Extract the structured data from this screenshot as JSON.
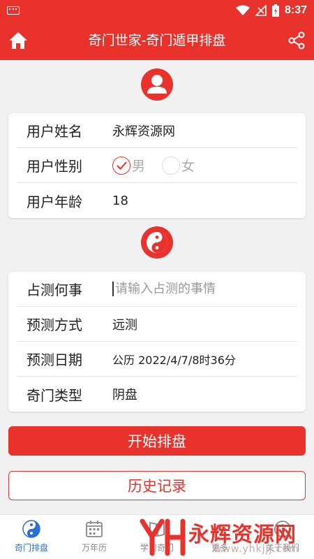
{
  "status_bar": {
    "time": "8:37"
  },
  "header": {
    "title": "奇门世家-奇门遁甲排盘"
  },
  "user_card": {
    "name_label": "用户姓名",
    "name_value": "永辉资源网",
    "gender_label": "用户性别",
    "gender_options": [
      {
        "label": "男",
        "selected": true
      },
      {
        "label": "女",
        "selected": false
      }
    ],
    "age_label": "用户年龄",
    "age_value": "18"
  },
  "divination_card": {
    "matter_label": "占测何事",
    "matter_placeholder": "请输入占测的事情",
    "method_label": "预测方式",
    "method_value": "远测",
    "date_label": "预测日期",
    "date_value": "公历 2022/4/7/8时36分",
    "type_label": "奇门类型",
    "type_value": "阴盘"
  },
  "buttons": {
    "start": "开始排盘",
    "history": "历史记录"
  },
  "bottom_nav": [
    {
      "label": "奇门排盘",
      "icon": "yin-yang-icon",
      "active": true
    },
    {
      "label": "万年历",
      "icon": "calendar-icon",
      "active": false
    },
    {
      "label": "学习奇门",
      "icon": "book-icon",
      "active": false
    },
    {
      "label": "更多",
      "icon": "more-icon",
      "active": false
    },
    {
      "label": "关于我们",
      "icon": "about-icon",
      "active": false
    }
  ],
  "watermark": {
    "text": "永辉资源网",
    "url": "www.yhkjjj.com"
  },
  "colors": {
    "brand": "#e8322b",
    "active_nav": "#2a6fd6"
  }
}
